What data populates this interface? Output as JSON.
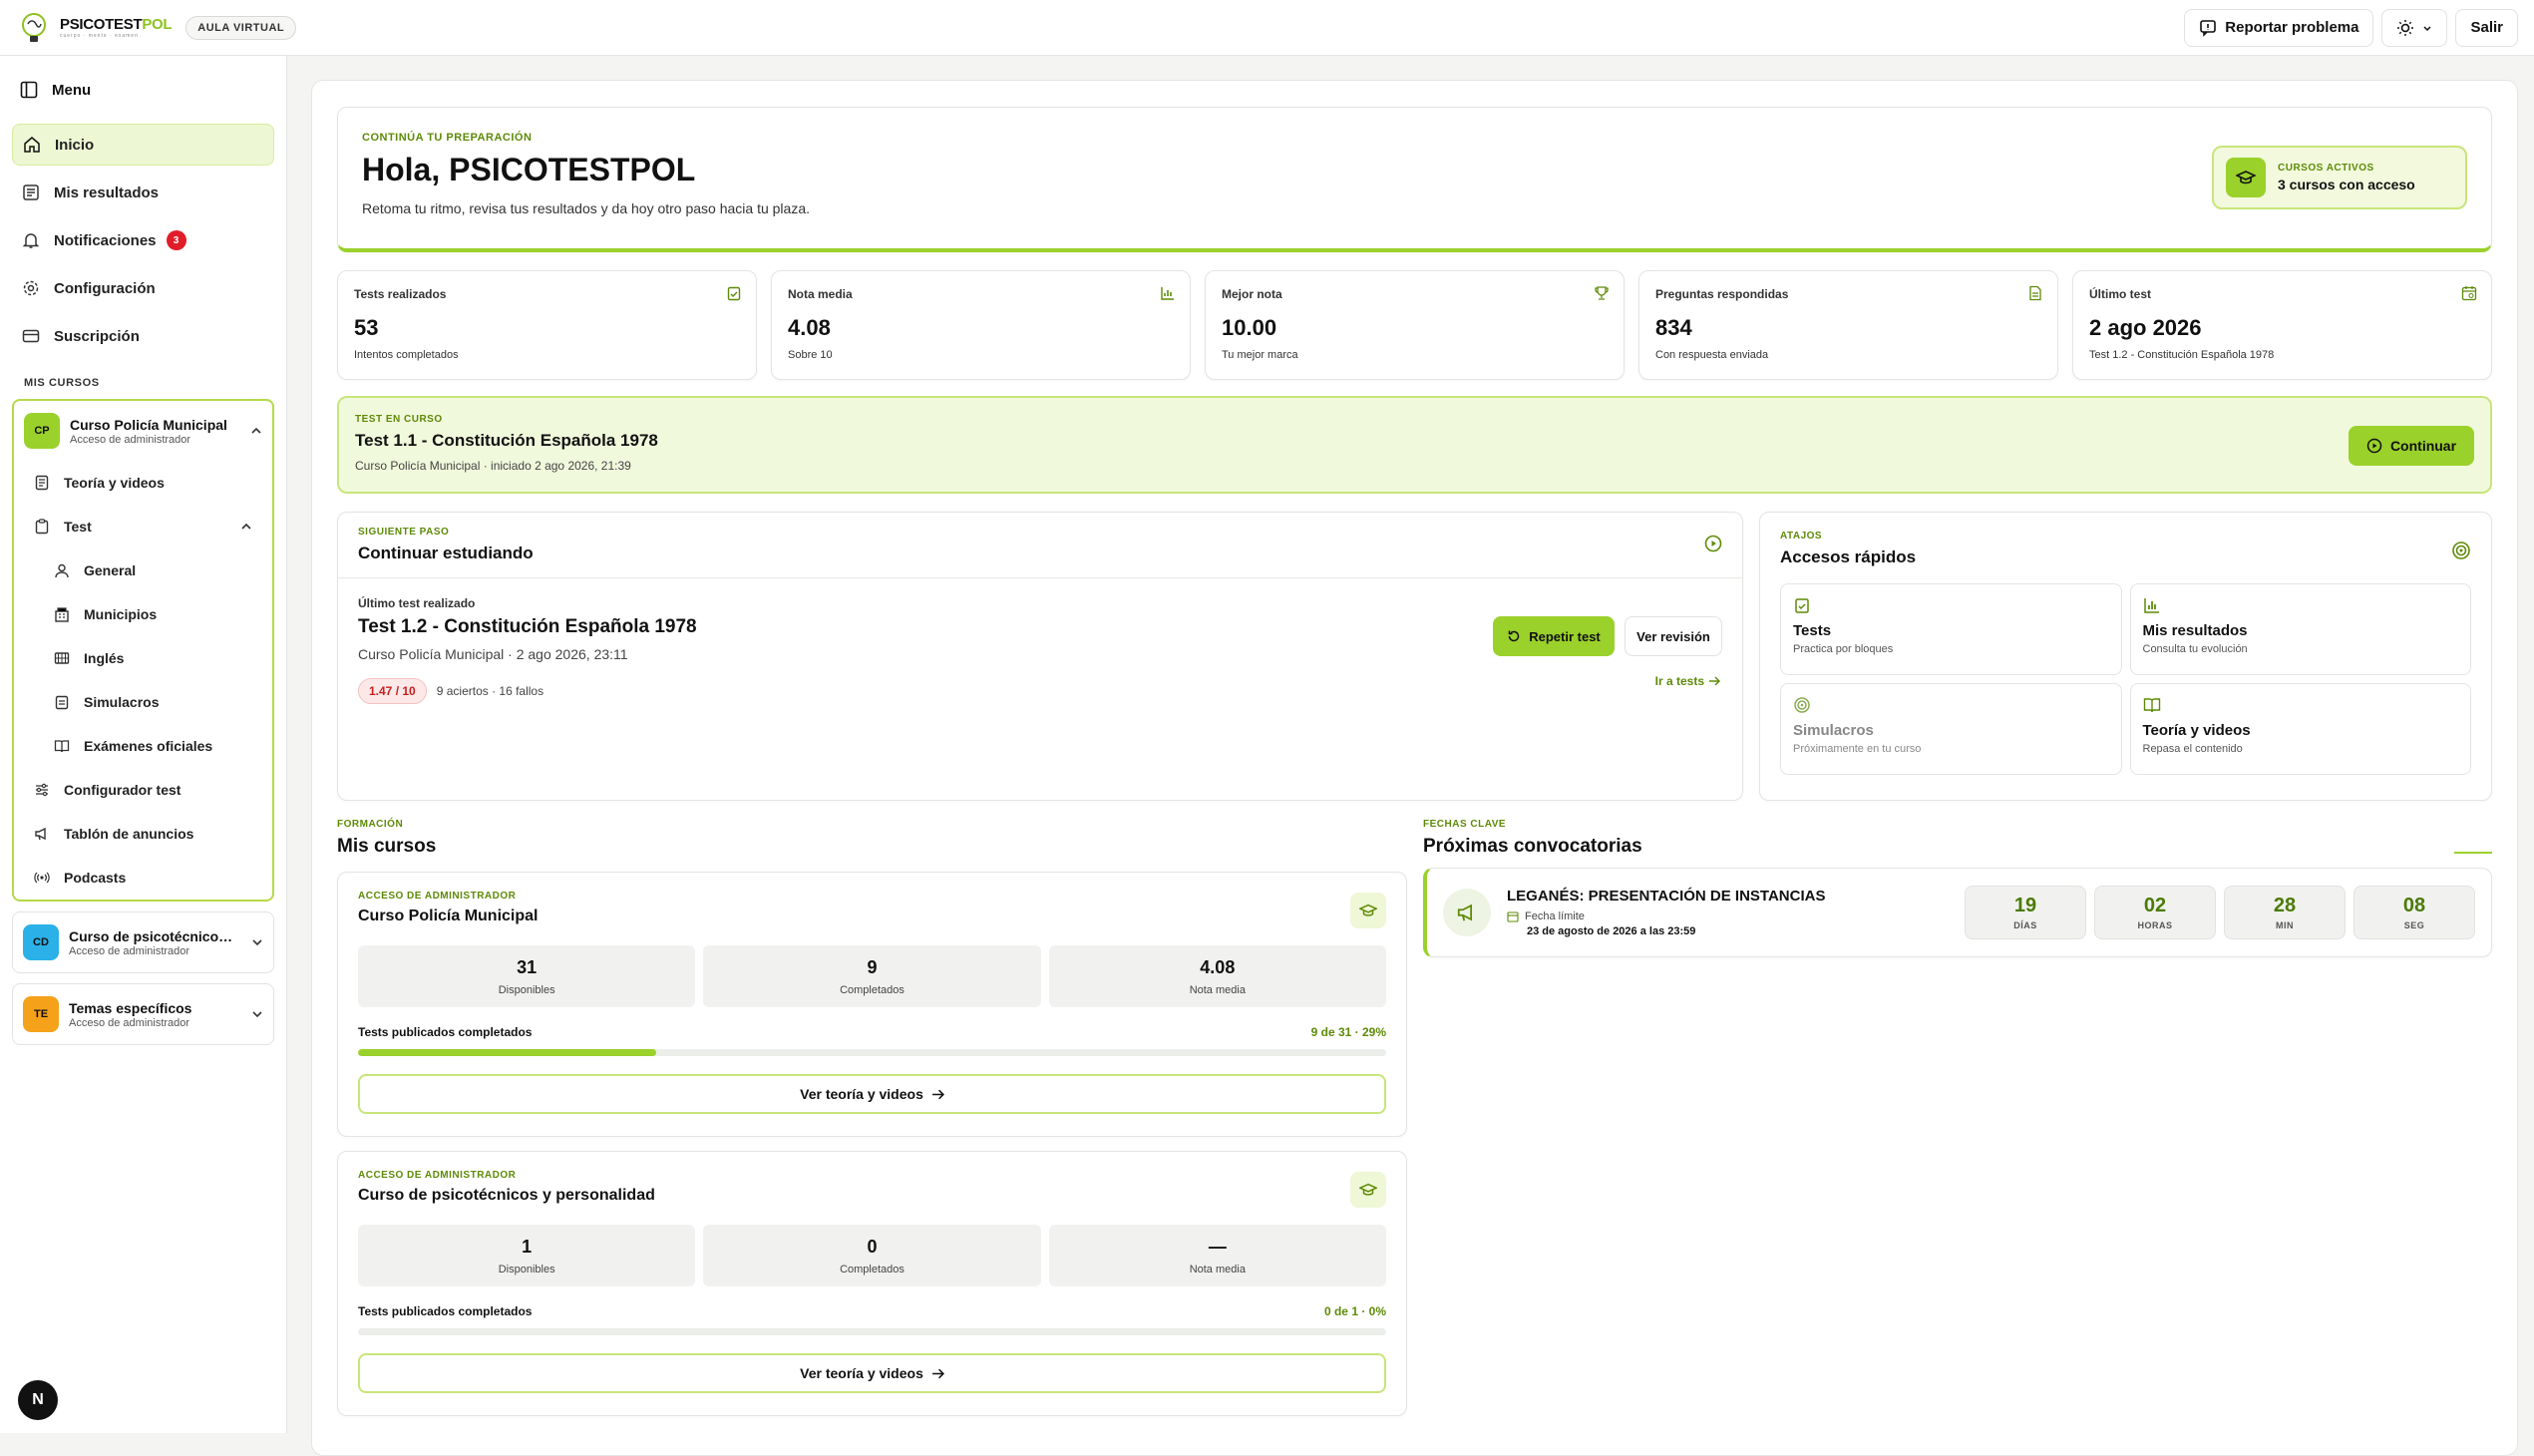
{
  "brand": {
    "name_a": "PSICOTEST",
    "name_b": "POL",
    "tagline": "cuerpo · mente · examen",
    "area": "AULA VIRTUAL"
  },
  "topbar": {
    "report": "Reportar problema",
    "logout": "Salir"
  },
  "sidebar": {
    "menu": "Menu",
    "items": [
      {
        "label": "Inicio"
      },
      {
        "label": "Mis resultados"
      },
      {
        "label": "Notificaciones",
        "badge": "3"
      },
      {
        "label": "Configuración"
      },
      {
        "label": "Suscripción"
      }
    ],
    "courses_label": "MIS CURSOS",
    "courses": [
      {
        "code": "CP",
        "title": "Curso Policía Municipal",
        "sub": "Acceso de administrador"
      },
      {
        "code": "CD",
        "title": "Curso de psicotécnicos y personalidad",
        "sub": "Acceso de administrador"
      },
      {
        "code": "TE",
        "title": "Temas específicos",
        "sub": "Acceso de administrador"
      }
    ],
    "course_menu": {
      "theory": "Teoría y videos",
      "test": "Test",
      "test_sub": [
        "General",
        "Municipios",
        "Inglés",
        "Simulacros",
        "Exámenes oficiales"
      ],
      "config": "Configurador test",
      "board": "Tablón de anuncios",
      "podcasts": "Podcasts"
    },
    "n": "N"
  },
  "hero": {
    "eyebrow": "CONTINÚA TU PREPARACIÓN",
    "title": "Hola, PSICOTESTPOL",
    "text": "Retoma tu ritmo, revisa tus resultados y da hoy otro paso hacia tu plaza.",
    "active_label": "CURSOS ACTIVOS",
    "active_value": "3 cursos con acceso"
  },
  "stats": [
    {
      "label": "Tests realizados",
      "value": "53",
      "sub": "Intentos completados"
    },
    {
      "label": "Nota media",
      "value": "4.08",
      "sub": "Sobre 10"
    },
    {
      "label": "Mejor nota",
      "value": "10.00",
      "sub": "Tu mejor marca"
    },
    {
      "label": "Preguntas respondidas",
      "value": "834",
      "sub": "Con respuesta enviada"
    },
    {
      "label": "Último test",
      "value": "2 ago 2026",
      "sub": "Test 1.2 - Constitución Española 1978"
    }
  ],
  "in_progress": {
    "eyebrow": "TEST EN CURSO",
    "title": "Test 1.1 - Constitución Española 1978",
    "sub": "Curso Policía Municipal · iniciado 2 ago 2026, 21:39",
    "button": "Continuar"
  },
  "next_step": {
    "eyebrow": "SIGUIENTE PASO",
    "title": "Continuar estudiando",
    "caption": "Último test realizado",
    "test": "Test 1.2 - Constitución Española 1978",
    "meta": "Curso Policía Municipal · 2 ago 2026, 23:11",
    "score": "1.47 / 10",
    "result": "9 aciertos · 16 fallos",
    "repeat": "Repetir test",
    "review": "Ver revisión",
    "goto": "Ir a tests"
  },
  "shortcuts": {
    "eyebrow": "ATAJOS",
    "title": "Accesos rápidos",
    "items": [
      {
        "title": "Tests",
        "sub": "Practica por bloques"
      },
      {
        "title": "Mis resultados",
        "sub": "Consulta tu evolución"
      },
      {
        "title": "Simulacros",
        "sub": "Próximamente en tu curso"
      },
      {
        "title": "Teoría y videos",
        "sub": "Repasa el contenido"
      }
    ]
  },
  "courses": {
    "eyebrow": "FORMACIÓN",
    "title": "Mis cursos",
    "cards": [
      {
        "access": "ACCESO DE ADMINISTRADOR",
        "title": "Curso Policía Municipal",
        "available": "31",
        "completed": "9",
        "avg": "4.08",
        "l_available": "Disponibles",
        "l_completed": "Completados",
        "l_avg": "Nota media",
        "progress_label": "Tests publicados completados",
        "progress_text": "9 de 31 · 29%",
        "progress": 0.29,
        "button": "Ver teoría y videos"
      },
      {
        "access": "ACCESO DE ADMINISTRADOR",
        "title": "Curso de psicotécnicos y personalidad",
        "available": "1",
        "completed": "0",
        "avg": "—",
        "l_available": "Disponibles",
        "l_completed": "Completados",
        "l_avg": "Nota media",
        "progress_label": "Tests publicados completados",
        "progress_text": "0 de 1 · 0%",
        "progress": 0,
        "button": "Ver teoría y videos"
      }
    ]
  },
  "dates": {
    "eyebrow": "FECHAS CLAVE",
    "title": "Próximas convocatorias",
    "item": {
      "title": "LEGANÉS: PRESENTACIÓN DE INSTANCIAS",
      "flabel": "Fecha límite",
      "date": "23 de agosto de 2026 a las 23:59"
    },
    "countdown": [
      {
        "v": "19",
        "l": "DÍAS"
      },
      {
        "v": "02",
        "l": "HORAS"
      },
      {
        "v": "28",
        "l": "MIN"
      },
      {
        "v": "08",
        "l": "SEG"
      }
    ]
  },
  "colors": {
    "accent": "#9ad12b",
    "accent_dark": "#5e8a07",
    "danger": "#e11d2a"
  }
}
